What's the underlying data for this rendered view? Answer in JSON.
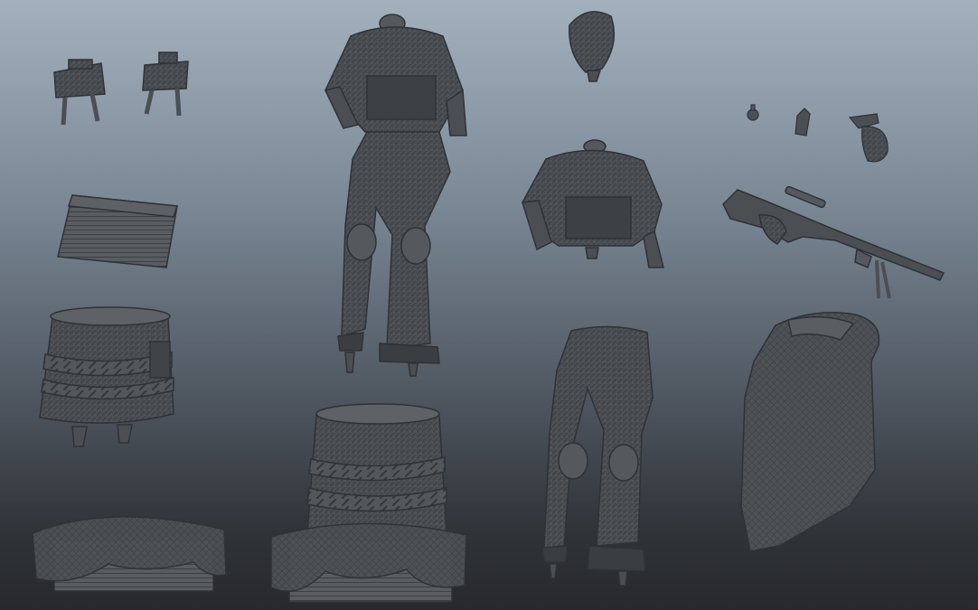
{
  "viewport": {
    "background_top": "#a3b0bd",
    "background_bottom": "#27292c",
    "model_fill": "#4b4e53",
    "model_dark": "#2f3236",
    "model_light": "#6c7076"
  },
  "parts": [
    "claymore-mine",
    "claymore-mine",
    "supply-crate",
    "barrel-base",
    "ground-base-left",
    "full-soldier-figure",
    "barrel-on-base",
    "head",
    "torso-vest",
    "legs",
    "grenade",
    "canister",
    "pistol-hand",
    "sniper-rifle",
    "cloak"
  ]
}
